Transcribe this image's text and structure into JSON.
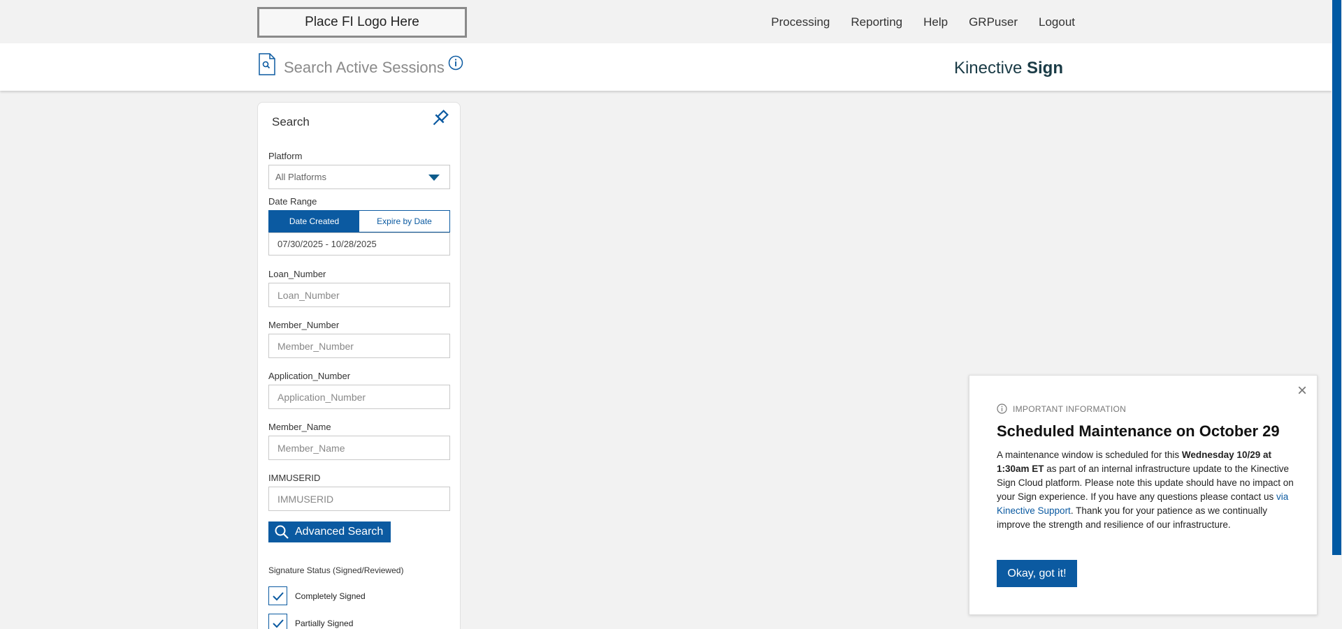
{
  "topbar": {
    "logo_text": "Place FI Logo Here",
    "nav": [
      "Processing",
      "Reporting",
      "Help",
      "GRPuser",
      "Logout"
    ]
  },
  "header": {
    "page_title": "Search Active Sessions",
    "brand_regular": "Kinective",
    "brand_bold": "Sign"
  },
  "search": {
    "title": "Search",
    "platform_label": "Platform",
    "platform_value": "All Platforms",
    "date_range_label": "Date Range",
    "date_created": "Date Created",
    "expire_by_date": "Expire by Date",
    "date_range_value": "07/30/2025 - 10/28/2025",
    "fields": [
      {
        "label": "Loan_Number",
        "placeholder": "Loan_Number"
      },
      {
        "label": "Member_Number",
        "placeholder": "Member_Number"
      },
      {
        "label": "Application_Number",
        "placeholder": "Application_Number"
      },
      {
        "label": "Member_Name",
        "placeholder": "Member_Name"
      },
      {
        "label": "IMMUSERID",
        "placeholder": "IMMUSERID"
      }
    ],
    "advanced_search": "Advanced Search",
    "signature_status_label": "Signature Status (Signed/Reviewed)",
    "checkboxes": [
      "Completely Signed",
      "Partially Signed"
    ]
  },
  "popup": {
    "kicker": "IMPORTANT INFORMATION",
    "title": "Scheduled Maintenance on October 29",
    "body_1": "A maintenance window is scheduled for this ",
    "body_bold": "Wednesday 10/29 at 1:30am ET",
    "body_2": " as part of an internal infrastructure update to the Kinective Sign Cloud platform. Please note this update should have no impact on your Sign experience. If you have any questions please contact us ",
    "body_link": "via Kinective Support",
    "body_3": ". Thank you for your patience as we continually improve the strength and resilience of our infrastructure.",
    "button": "Okay, got it!"
  },
  "colors": {
    "accent": "#0b5aa1",
    "brand_text": "#1a3b46",
    "background": "#f2f2f2"
  }
}
